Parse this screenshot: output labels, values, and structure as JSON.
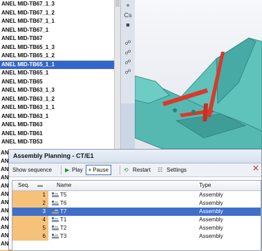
{
  "tree": {
    "items": [
      "ANEL MID-TB67_1_3",
      "ANEL MID-TB67_1_2",
      "ANEL MID-TB67_1_1",
      "ANEL MID-TB67_1",
      "ANEL MID-TB67",
      "ANEL MID-TB65_1_3",
      "ANEL MID-TB65_1_2",
      "ANEL MID-TB65_1_1",
      "ANEL MID-TB65_1",
      "ANEL MID-TB65",
      "ANEL MID-TB63_1_3",
      "ANEL MID-TB63_1_2",
      "ANEL MID-TB63_1_1",
      "ANEL MID-TB63_1",
      "ANEL MID-TB63",
      "ANEL MID-TB61",
      "ANEL MID-TB53"
    ],
    "selected_index": 7,
    "strip_items": [
      "ANI",
      "ANI",
      "ANI",
      "ANI",
      "ANI",
      "ANI",
      "ANI",
      "ANI",
      "ANI",
      "ANI",
      "ANI",
      "ANI"
    ]
  },
  "panel": {
    "title": "Assembly Planning - CT/E1",
    "toolbar": {
      "show_sequence": "Show sequence",
      "play": "Play",
      "pause": "Pause",
      "restart": "Restart",
      "settings": "Settings"
    },
    "columns": {
      "seq": "Seq.",
      "name": "Name",
      "type": "Type"
    },
    "rows": [
      {
        "seq": "1",
        "name": "T5",
        "type": "Assembly"
      },
      {
        "seq": "2",
        "name": "T6",
        "type": "Assembly"
      },
      {
        "seq": "3",
        "name": "T7",
        "type": "Assembly"
      },
      {
        "seq": "4",
        "name": "T1",
        "type": "Assembly"
      },
      {
        "seq": "5",
        "name": "T2",
        "type": "Assembly"
      },
      {
        "seq": "6",
        "name": "T3",
        "type": "Assembly"
      }
    ],
    "selected_row": 2
  },
  "colors": {
    "frame": "#f1a23a",
    "selection": "#3f6fc9",
    "model_teal": "#4fb6b0",
    "model_red": "#d9392b"
  }
}
